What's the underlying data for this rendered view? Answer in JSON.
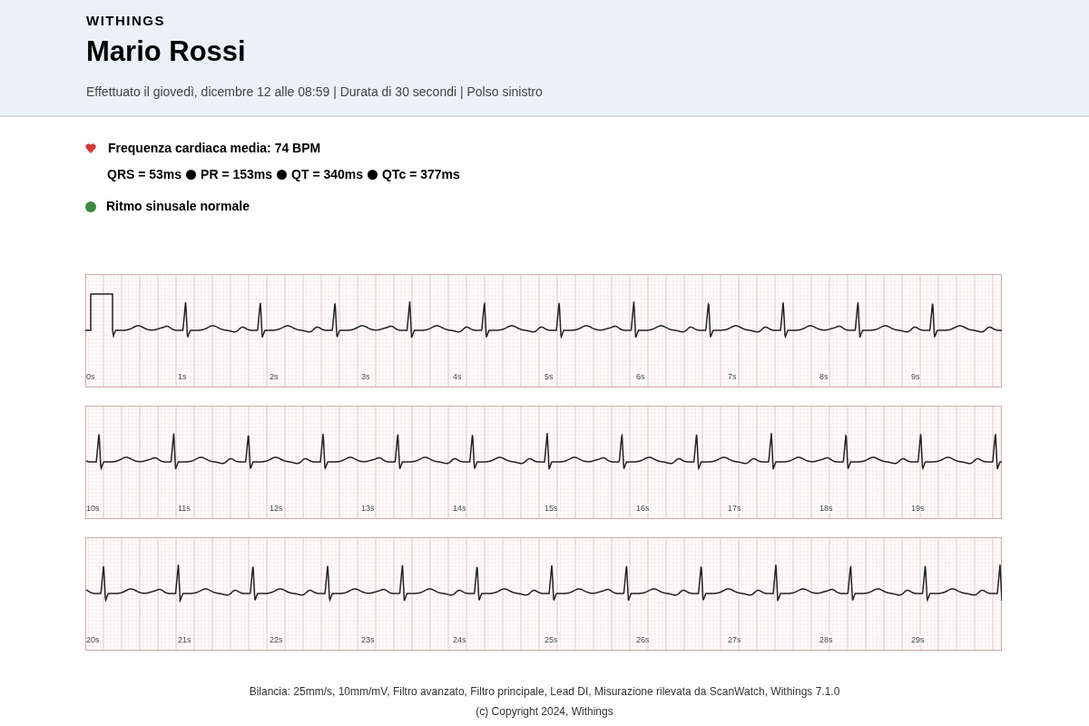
{
  "header": {
    "brand": "WITHINGS",
    "patient": "Mario Rossi",
    "details": "Effettuato il giovedì, dicembre 12 alle 08:59 | Durata di 30 secondi | Polso sinistro"
  },
  "summary": {
    "heart_rate": "Frequenza cardiaca media: 74 BPM",
    "intervals": [
      "QRS = 53ms",
      "PR = 153ms",
      "QT = 340ms",
      "QTc = 377ms"
    ],
    "rhythm": {
      "label": "Ritmo sinusale normale",
      "color": "#3a8a3f"
    }
  },
  "strips": [
    {
      "calibration": true,
      "labels": [
        "0s",
        "1s",
        "2s",
        "3s",
        "4s",
        "5s",
        "6s",
        "7s",
        "8s",
        "9s"
      ]
    },
    {
      "calibration": false,
      "labels": [
        "10s",
        "11s",
        "12s",
        "13s",
        "14s",
        "15s",
        "16s",
        "17s",
        "18s",
        "19s"
      ]
    },
    {
      "calibration": false,
      "labels": [
        "20s",
        "21s",
        "22s",
        "23s",
        "24s",
        "25s",
        "26s",
        "27s",
        "28s",
        "29s"
      ]
    }
  ],
  "footer": [
    "Bilancia: 25mm/s, 10mm/mV, Filtro avanzato, Filtro principale, Lead DI, Misurazione rilevata da ScanWatch, Withings 7.1.0",
    "(c) Copyright 2024, Withings"
  ]
}
